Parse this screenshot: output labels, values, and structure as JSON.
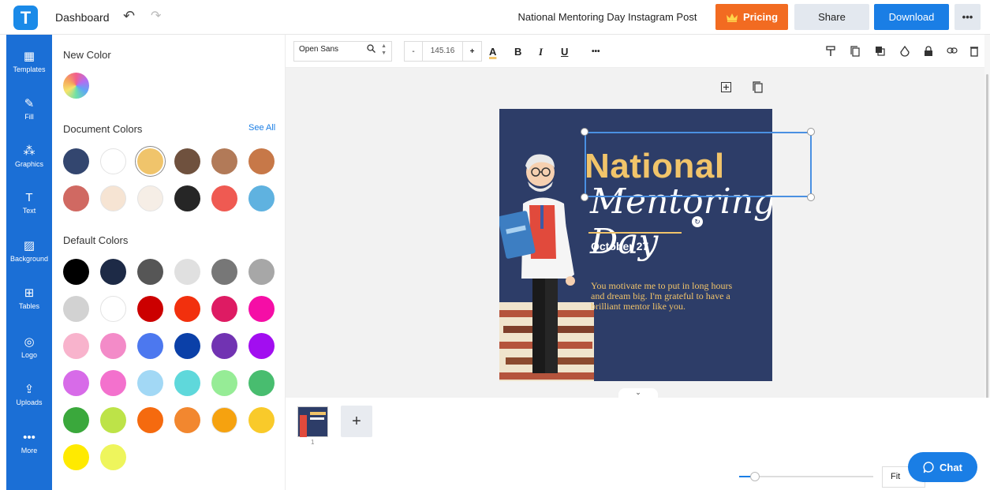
{
  "topbar": {
    "logo_letter": "T",
    "dashboard_label": "Dashboard",
    "undo_icon": "↶",
    "redo_icon": "↷",
    "doc_title": "National Mentoring Day Instagram Post",
    "pricing_label": "Pricing",
    "share_label": "Share",
    "download_label": "Download",
    "more_label": "•••"
  },
  "nav": {
    "items": [
      {
        "label": "Templates",
        "icon": "▦"
      },
      {
        "label": "Fill",
        "icon": "✎"
      },
      {
        "label": "Graphics",
        "icon": "⁂"
      },
      {
        "label": "Text",
        "icon": "T"
      },
      {
        "label": "Background",
        "icon": "▨"
      },
      {
        "label": "Tables",
        "icon": "⊞"
      },
      {
        "label": "Logo",
        "icon": "◎"
      },
      {
        "label": "Uploads",
        "icon": "⇪"
      },
      {
        "label": "More",
        "icon": "•••"
      }
    ]
  },
  "panel": {
    "new_color_title": "New Color",
    "document_colors_title": "Document Colors",
    "see_all": "See All",
    "default_colors_title": "Default Colors",
    "document_colors": [
      "#33466f",
      "#ffffff",
      "#f0c46b",
      "#6f513e",
      "#b27a58",
      "#c77848",
      "#d06962",
      "#f6e4d3",
      "#f6eee6",
      "#262626",
      "#ef5a52",
      "#5fb2e0"
    ],
    "default_colors": [
      "#000000",
      "#1d2a46",
      "#565656",
      "#e0e0e0",
      "#777777",
      "#a7a7a7",
      "#d2d2d2",
      "#ffffff",
      "#cc0000",
      "#f2300d",
      "#de1b63",
      "#f50ea6",
      "#f8b3cc",
      "#f38bc8",
      "#4c78ef",
      "#0b40a8",
      "#7133b2",
      "#a20ef0",
      "#d76be8",
      "#f371cd",
      "#a2d8f5",
      "#5fd8db",
      "#96ec96",
      "#48bd6f",
      "#3aa83c",
      "#bde348",
      "#f56a0f",
      "#f2872f",
      "#f6a20f",
      "#f9ca2a",
      "#ffea00",
      "#eef55c"
    ]
  },
  "toolbar": {
    "font_name": "Open Sans",
    "minus": "-",
    "font_size": "145.16",
    "plus": "+",
    "color_a": "A",
    "bold": "B",
    "italic": "I",
    "underline": "U",
    "more": "•••"
  },
  "poster": {
    "title": "National",
    "script": "Mentoring Day",
    "date": "October 27",
    "message": "You motivate me to put in long hours and dream big. I'm grateful to have a brilliant mentor like you."
  },
  "pages": {
    "page_number": "1",
    "add": "+",
    "fit_label": "Fit",
    "chat_label": "Chat"
  }
}
